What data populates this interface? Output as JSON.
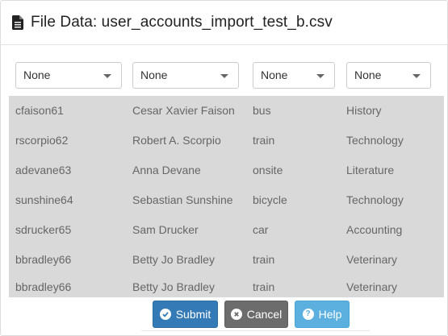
{
  "header": {
    "title": "File Data: user_accounts_import_test_b.csv",
    "icon": "file-text-icon"
  },
  "column_selects": [
    {
      "value": "None"
    },
    {
      "value": "None"
    },
    {
      "value": "None"
    },
    {
      "value": "None"
    }
  ],
  "rows": [
    {
      "username": "cfaison61",
      "name": "Cesar Xavier Faison",
      "transport": "bus",
      "subject": "History"
    },
    {
      "username": "rscorpio62",
      "name": "Robert A. Scorpio",
      "transport": "train",
      "subject": "Technology"
    },
    {
      "username": "adevane63",
      "name": "Anna Devane",
      "transport": "onsite",
      "subject": "Literature"
    },
    {
      "username": "sunshine64",
      "name": "Sebastian Sunshine",
      "transport": "bicycle",
      "subject": "Technology"
    },
    {
      "username": "sdrucker65",
      "name": "Sam Drucker",
      "transport": "car",
      "subject": "Accounting"
    },
    {
      "username": "bbradley66",
      "name": "Betty Jo Bradley",
      "transport": "train",
      "subject": "Veterinary"
    },
    {
      "username": "bbradley66",
      "name": "Betty Jo Bradley",
      "transport": "train",
      "subject": "Veterinary"
    }
  ],
  "buttons": {
    "submit": {
      "label": "Submit",
      "icon": "check-circle-icon",
      "color": "#337ab7"
    },
    "cancel": {
      "label": "Cancel",
      "icon": "times-circle-icon",
      "color": "#6c6c6c"
    },
    "help": {
      "label": "Help",
      "icon": "question-circle-icon",
      "color": "#5bb0e0"
    }
  },
  "colors": {
    "grid_background": "#d9d9d9",
    "row_text": "#666666"
  }
}
